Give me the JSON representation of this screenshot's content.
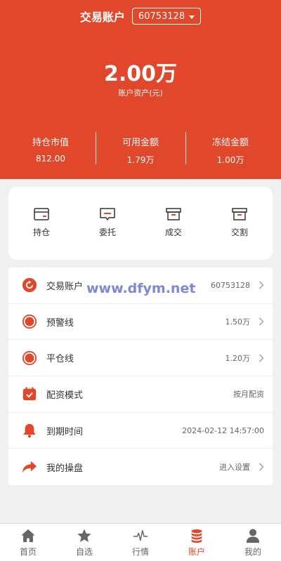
{
  "header": {
    "title": "交易账户",
    "account_select": "60753128",
    "total_value": "2.00万",
    "total_label": "账户资产(元)",
    "stats": [
      {
        "label": "持仓市值",
        "value": "812.00"
      },
      {
        "label": "可用金额",
        "value": "1.79万"
      },
      {
        "label": "冻结金额",
        "value": "1.00万"
      }
    ]
  },
  "quick_actions": [
    {
      "label": "持仓",
      "icon": "card-icon"
    },
    {
      "label": "委托",
      "icon": "message-icon"
    },
    {
      "label": "成交",
      "icon": "box-icon"
    },
    {
      "label": "交割",
      "icon": "box-icon"
    }
  ],
  "list": [
    {
      "label": "交易账户",
      "value": "60753128",
      "icon": "refresh-circle-icon"
    },
    {
      "label": "预警线",
      "value": "1.50万",
      "icon": "target-circle-icon"
    },
    {
      "label": "平仓线",
      "value": "1.20万",
      "icon": "target-circle-icon"
    },
    {
      "label": "配资模式",
      "value": "按月配资",
      "icon": "calendar-check-icon"
    },
    {
      "label": "到期时间",
      "value": "2024-02-12 14:57:00",
      "icon": "bell-icon"
    },
    {
      "label": "我的操盘",
      "value": "进入设置",
      "icon": "share-arrow-icon"
    }
  ],
  "watermark": "www.dfym.net",
  "tabbar": [
    {
      "label": "首页",
      "icon": "home-icon"
    },
    {
      "label": "自选",
      "icon": "star-icon"
    },
    {
      "label": "行情",
      "icon": "pulse-icon"
    },
    {
      "label": "账户",
      "icon": "coins-icon"
    },
    {
      "label": "我的",
      "icon": "user-icon"
    }
  ],
  "colors": {
    "accent": "#e0472b",
    "background": "#f0f0f0"
  }
}
